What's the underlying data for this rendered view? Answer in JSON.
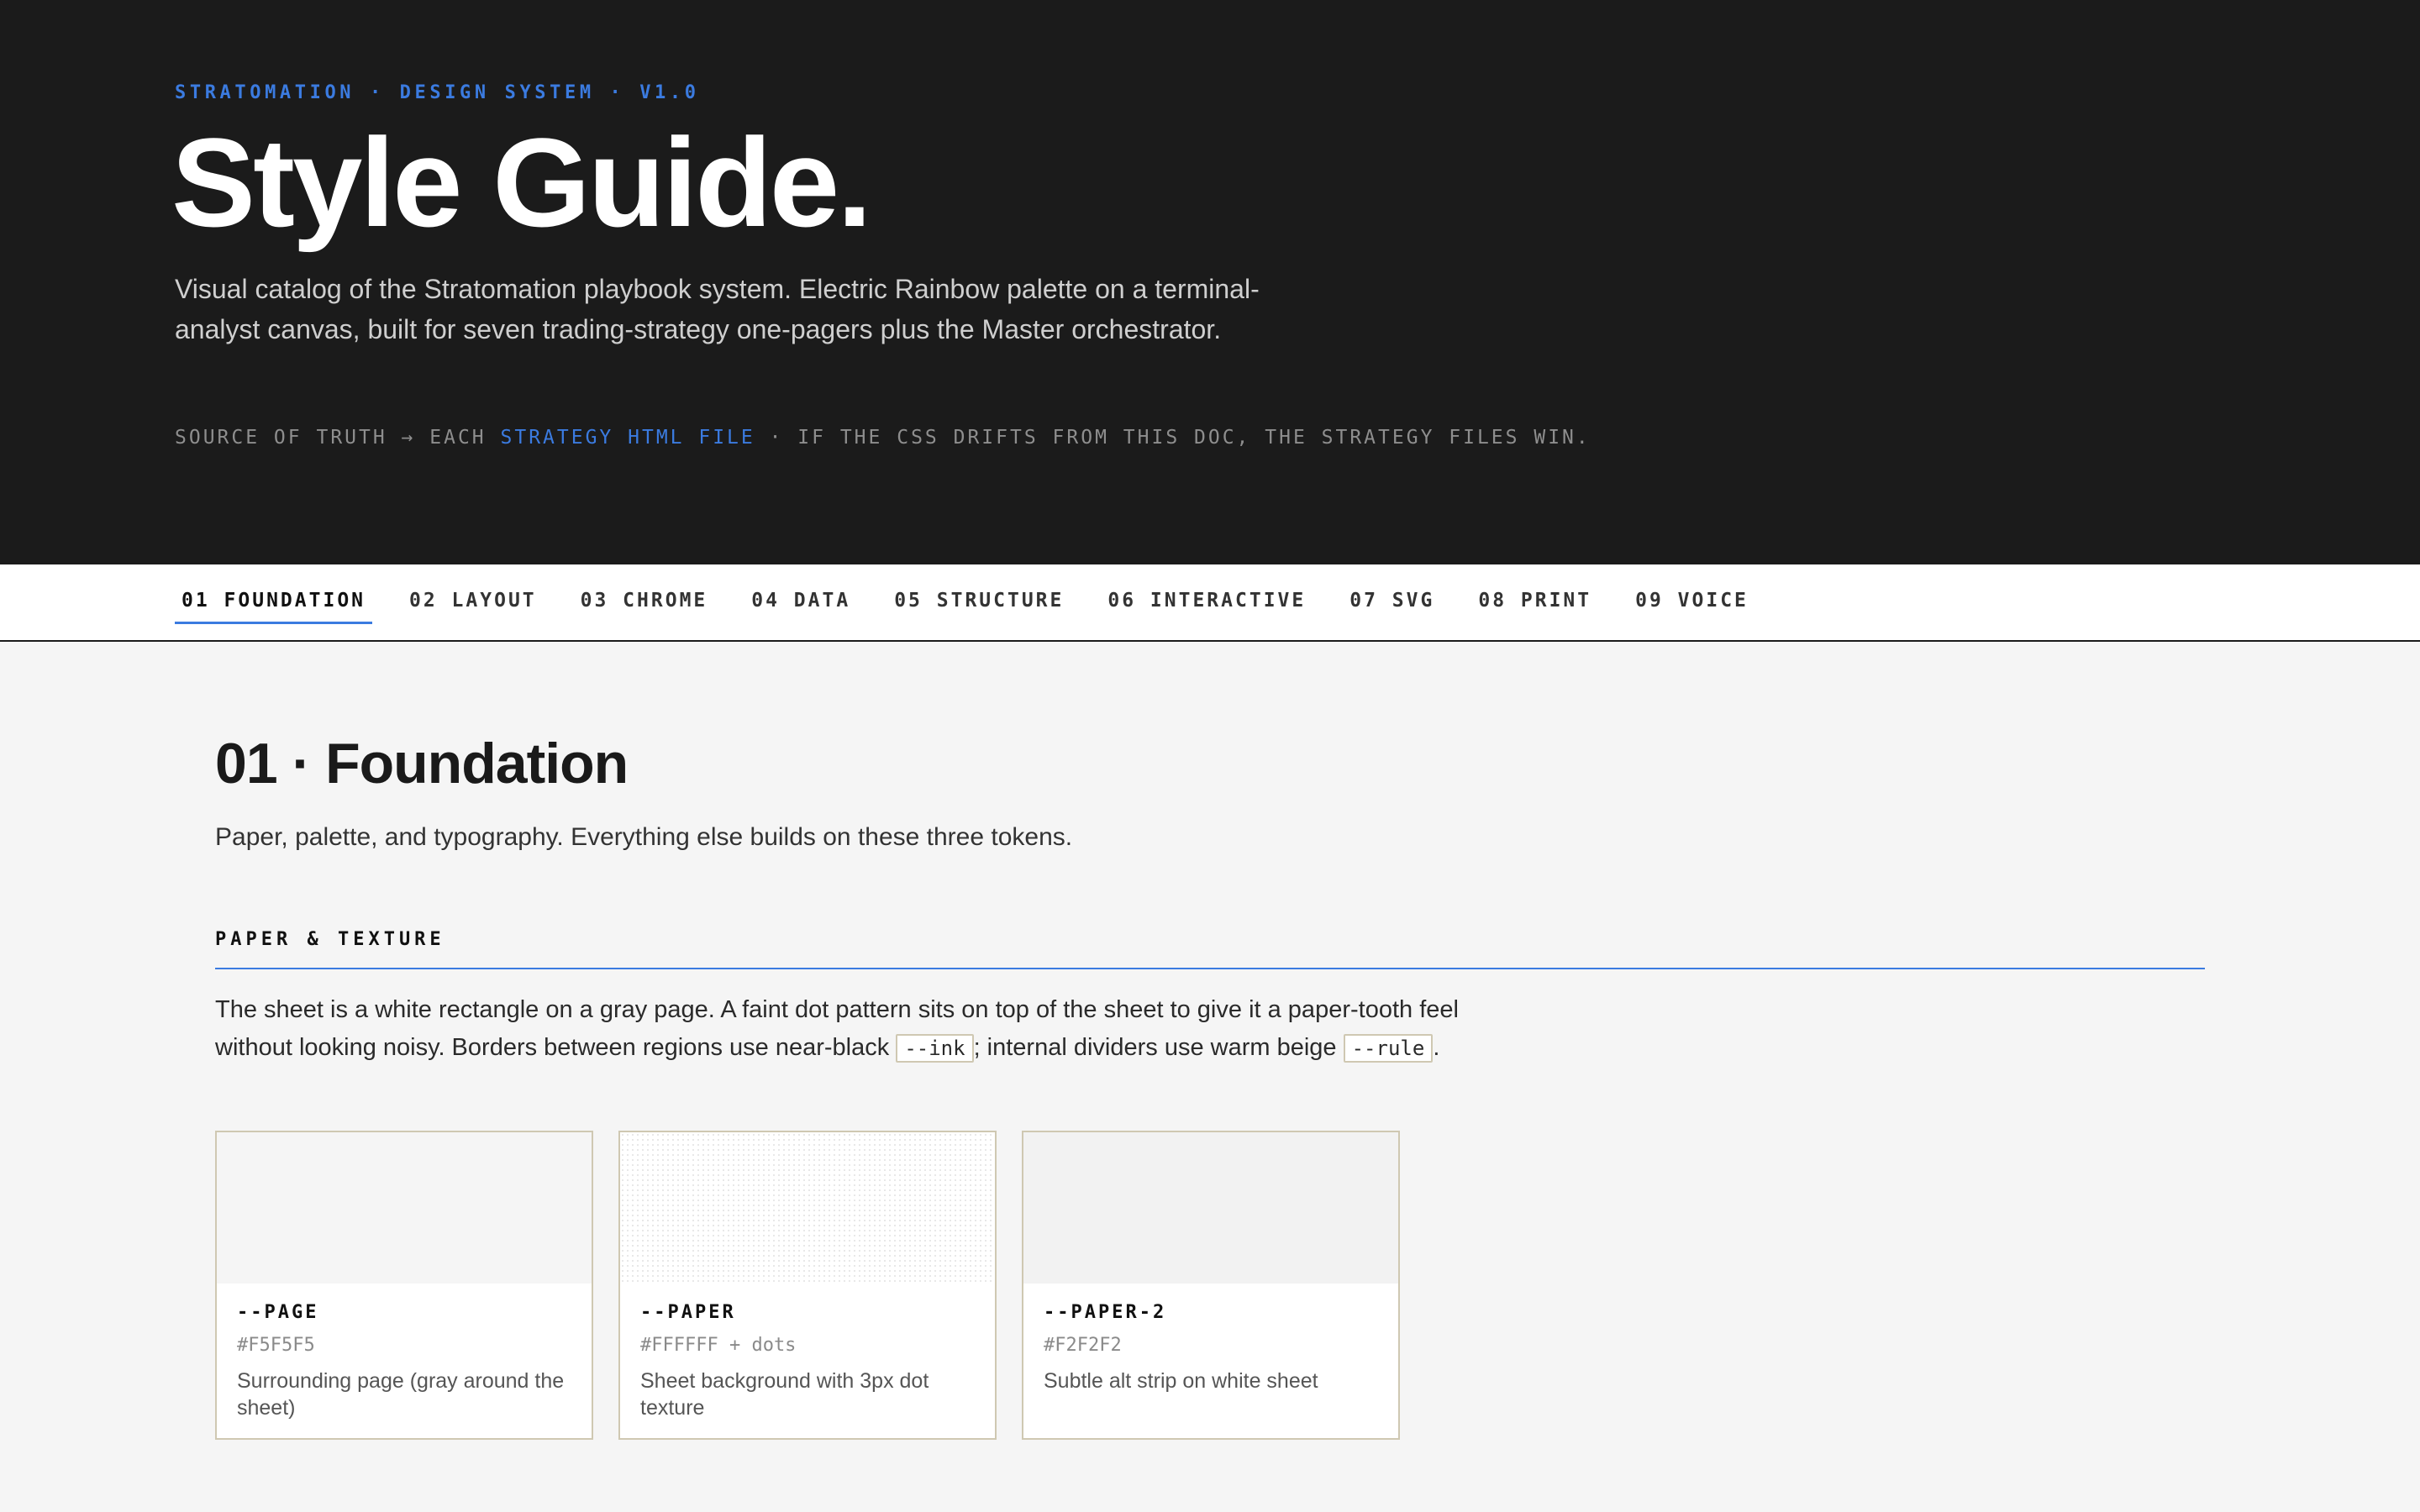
{
  "hero": {
    "eyebrow": "STRATOMATION · DESIGN SYSTEM · V1.0",
    "title": "Style Guide.",
    "lede": "Visual catalog of the Stratomation playbook system. Electric Rainbow palette on a terminal-analyst canvas, built for seven trading-strategy one-pagers plus the Master orchestrator.",
    "source_prefix": "SOURCE OF TRUTH → EACH ",
    "source_highlight": "STRATEGY HTML FILE",
    "source_suffix": " · IF THE CSS DRIFTS FROM THIS DOC, THE STRATEGY FILES WIN."
  },
  "nav": {
    "items": [
      {
        "label": "01 FOUNDATION",
        "active": true
      },
      {
        "label": "02 LAYOUT"
      },
      {
        "label": "03 CHROME"
      },
      {
        "label": "04 DATA"
      },
      {
        "label": "05 STRUCTURE"
      },
      {
        "label": "06 INTERACTIVE"
      },
      {
        "label": "07 SVG"
      },
      {
        "label": "08 PRINT"
      },
      {
        "label": "09 VOICE"
      }
    ]
  },
  "section": {
    "title": "01 · Foundation",
    "subtitle": "Paper, palette, and typography. Everything else builds on these three tokens.",
    "subsection": "PAPER & TEXTURE",
    "para_part1": "The sheet is a white rectangle on a gray page. A faint dot pattern sits on top of the sheet to give it a paper-tooth feel without looking noisy. Borders between regions use near-black ",
    "code1": "--ink",
    "para_part2": "; internal dividers use warm beige ",
    "code2": "--rule",
    "para_part3": "."
  },
  "cards": [
    {
      "name": "--PAGE",
      "hex": "#F5F5F5",
      "desc": "Surrounding page (gray around the sheet)"
    },
    {
      "name": "--PAPER",
      "hex": "#FFFFFF + dots",
      "desc": "Sheet background with 3px dot texture"
    },
    {
      "name": "--PAPER-2",
      "hex": "#F2F2F2",
      "desc": "Subtle alt strip on white sheet"
    }
  ],
  "colors": {
    "accent": "#3B7BE0",
    "ink": "#1a1a1a",
    "page": "#F5F5F5"
  }
}
